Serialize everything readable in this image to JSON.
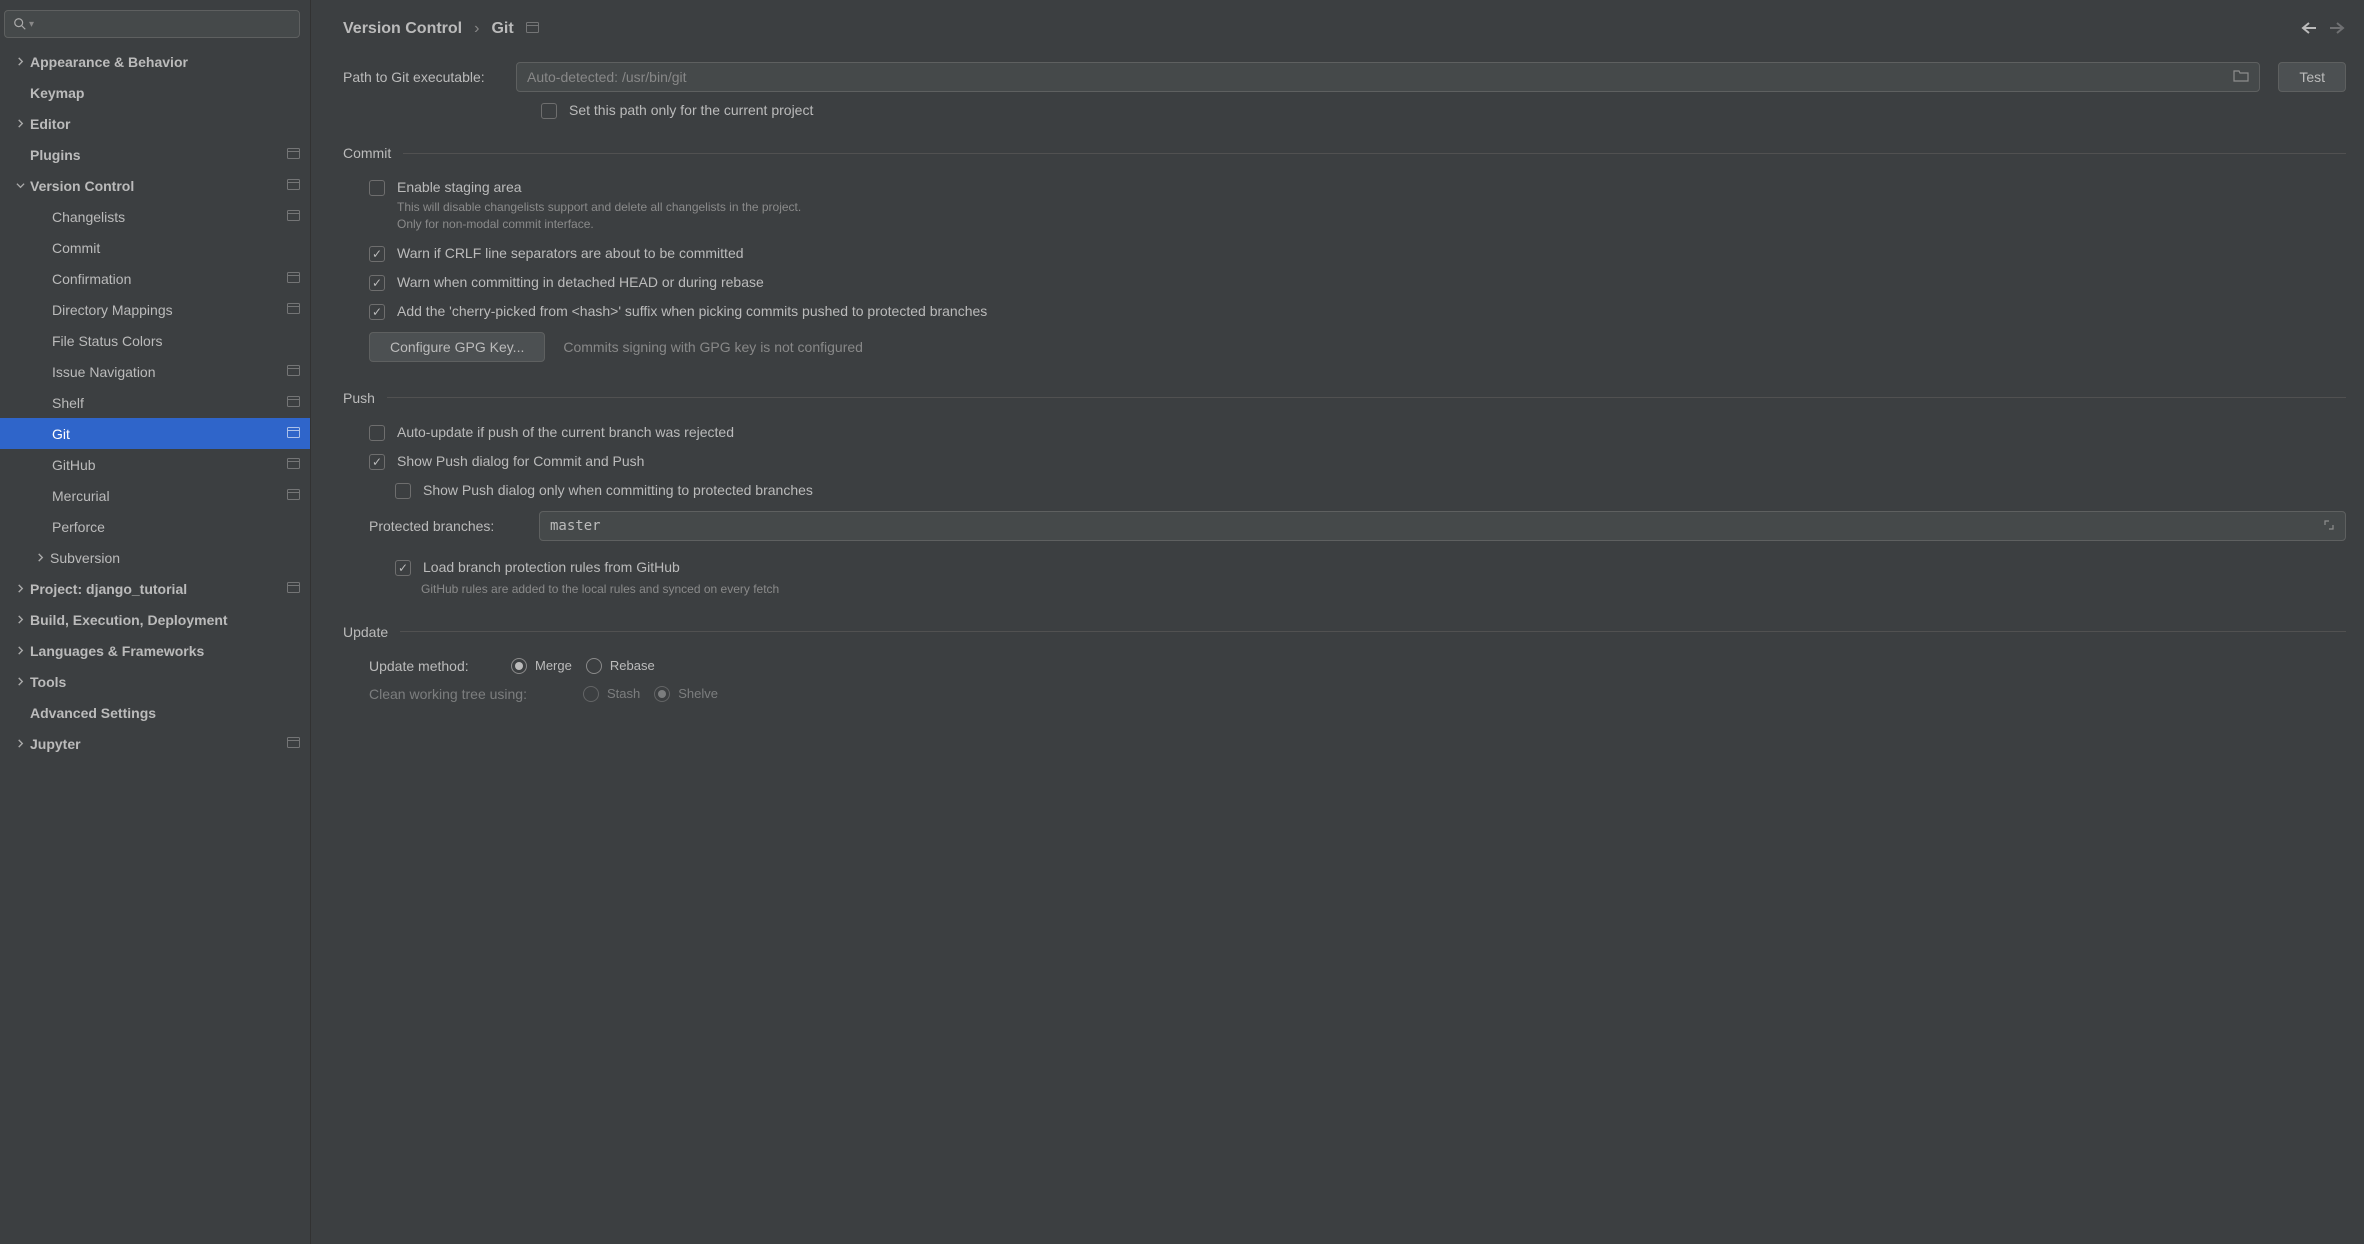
{
  "breadcrumb": {
    "root": "Version Control",
    "current": "Git"
  },
  "sidebar": {
    "items": [
      {
        "label": "Appearance & Behavior"
      },
      {
        "label": "Keymap"
      },
      {
        "label": "Editor"
      },
      {
        "label": "Plugins"
      },
      {
        "label": "Version Control"
      },
      {
        "label": "Changelists"
      },
      {
        "label": "Commit"
      },
      {
        "label": "Confirmation"
      },
      {
        "label": "Directory Mappings"
      },
      {
        "label": "File Status Colors"
      },
      {
        "label": "Issue Navigation"
      },
      {
        "label": "Shelf"
      },
      {
        "label": "Git"
      },
      {
        "label": "GitHub"
      },
      {
        "label": "Mercurial"
      },
      {
        "label": "Perforce"
      },
      {
        "label": "Subversion"
      },
      {
        "label": "Project: django_tutorial"
      },
      {
        "label": "Build, Execution, Deployment"
      },
      {
        "label": "Languages & Frameworks"
      },
      {
        "label": "Tools"
      },
      {
        "label": "Advanced Settings"
      },
      {
        "label": "Jupyter"
      }
    ]
  },
  "path_row": {
    "label": "Path to Git executable:",
    "placeholder": "Auto-detected: /usr/bin/git",
    "test": "Test",
    "set_only_project": "Set this path only for the current project"
  },
  "commit": {
    "title": "Commit",
    "enable_staging": "Enable staging area",
    "enable_staging_help": "This will disable changelists support and delete all changelists in the project. Only for non-modal commit interface.",
    "warn_crlf": "Warn if CRLF line separators are about to be committed",
    "warn_detached": "Warn when committing in detached HEAD or during rebase",
    "cherry_suffix": "Add the 'cherry-picked from <hash>' suffix when picking commits pushed to protected branches",
    "gpg_button": "Configure GPG Key...",
    "gpg_status": "Commits signing with GPG key is not configured"
  },
  "push": {
    "title": "Push",
    "auto_update": "Auto-update if push of the current branch was rejected",
    "show_dialog": "Show Push dialog for Commit and Push",
    "show_dialog_protected": "Show Push dialog only when committing to protected branches",
    "protected_label": "Protected branches:",
    "protected_value": "master",
    "load_github": "Load branch protection rules from GitHub",
    "load_github_help": "GitHub rules are added to the local rules and synced on every fetch"
  },
  "update": {
    "title": "Update",
    "method_label": "Update method:",
    "merge": "Merge",
    "rebase": "Rebase",
    "clean_label": "Clean working tree using:",
    "stash": "Stash",
    "shelve": "Shelve"
  }
}
